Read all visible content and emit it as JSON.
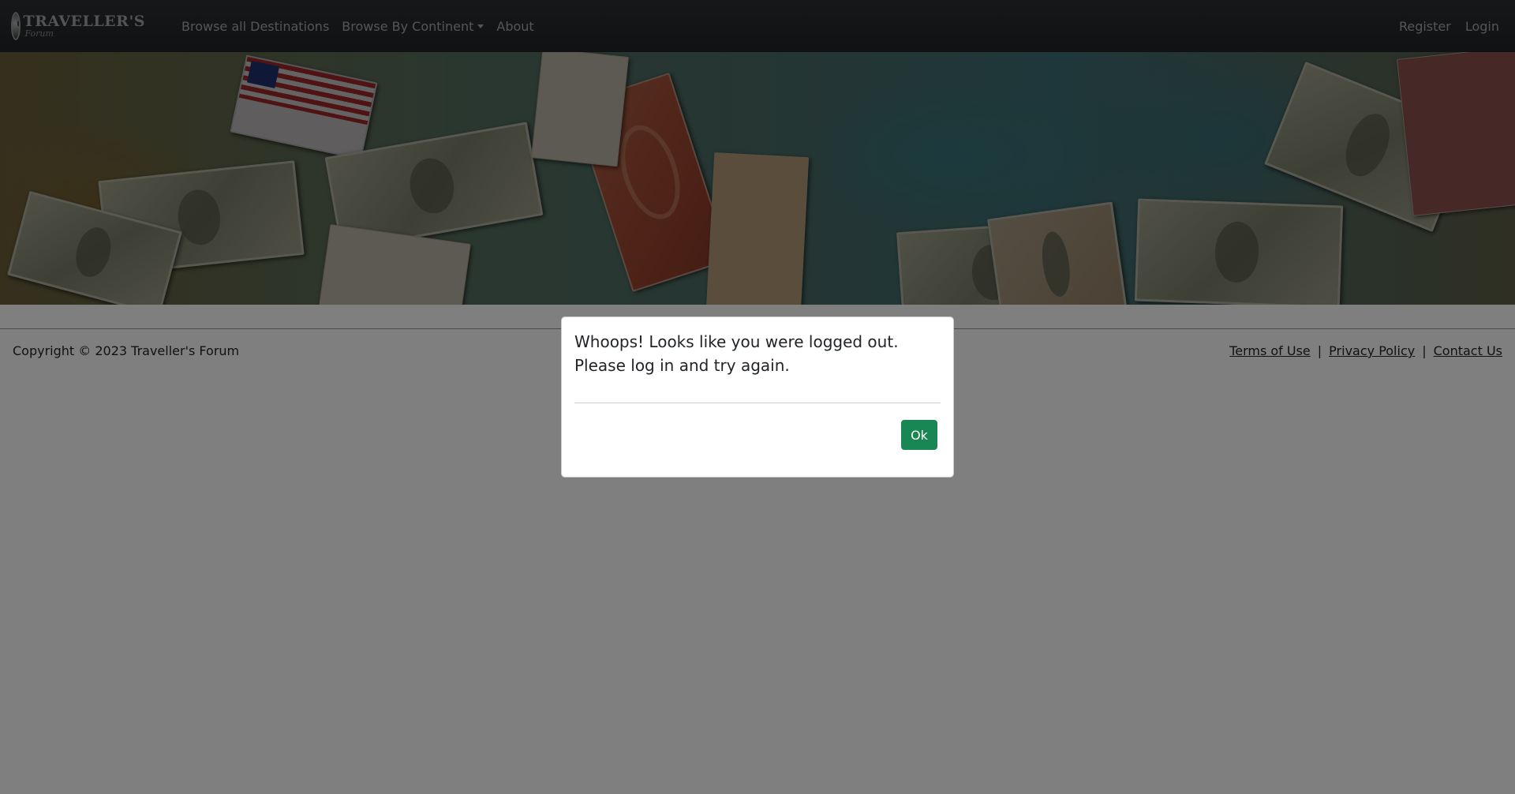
{
  "navbar": {
    "brand_title": "TRAVELLER'S",
    "brand_subtitle": "Forum",
    "links": [
      {
        "label": "Browse all Destinations"
      },
      {
        "label": "Browse By Continent",
        "has_dropdown": true
      },
      {
        "label": "About"
      }
    ],
    "right_links": [
      {
        "label": "Register"
      },
      {
        "label": "Login"
      }
    ]
  },
  "hero": {
    "description_icon": "currency-collage-banner"
  },
  "footer": {
    "copyright": "Copyright © 2023 Traveller's Forum",
    "links": [
      {
        "label": "Terms of Use"
      },
      {
        "label": "Privacy Policy"
      },
      {
        "label": "Contact Us"
      }
    ],
    "separator": "|"
  },
  "modal": {
    "message": "Whoops! Looks like you were logged out. Please log in and try again.",
    "ok_label": "Ok",
    "ok_color": "#198754"
  },
  "colors": {
    "navbar_bg": "#212427",
    "nav_text": "#a8abae",
    "backdrop": "rgba(0,0,0,0.5)"
  }
}
